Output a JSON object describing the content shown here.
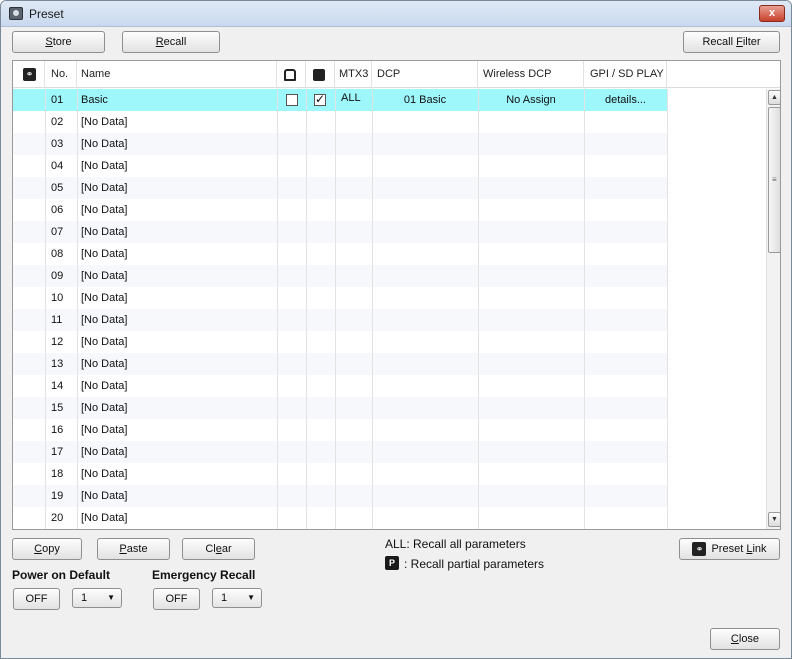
{
  "window": {
    "title": "Preset",
    "close_label": "x"
  },
  "toolbar": {
    "store": {
      "u": "S",
      "rest": "tore"
    },
    "recall": {
      "u": "R",
      "rest": "ecall"
    },
    "recall_filter": {
      "pre": "Recall ",
      "u": "F",
      "rest": "ilter"
    }
  },
  "columns": {
    "link_icon": "link-icon",
    "no": "No.",
    "name": "Name",
    "protect_icon": "lock-icon",
    "clock_icon": "clock-icon",
    "mtx": "MTX3",
    "dcp": "DCP",
    "wdcp": "Wireless DCP",
    "gpi": "GPI / SD PLAY"
  },
  "rows": [
    {
      "no": "01",
      "name": "Basic",
      "protect": false,
      "recall_safe": true,
      "mtx": "ALL",
      "dcp": "01 Basic",
      "wdcp": "No Assign",
      "gpi": "details..."
    },
    {
      "no": "02",
      "name": "[No Data]"
    },
    {
      "no": "03",
      "name": "[No Data]"
    },
    {
      "no": "04",
      "name": "[No Data]"
    },
    {
      "no": "05",
      "name": "[No Data]"
    },
    {
      "no": "06",
      "name": "[No Data]"
    },
    {
      "no": "07",
      "name": "[No Data]"
    },
    {
      "no": "08",
      "name": "[No Data]"
    },
    {
      "no": "09",
      "name": "[No Data]"
    },
    {
      "no": "10",
      "name": "[No Data]"
    },
    {
      "no": "11",
      "name": "[No Data]"
    },
    {
      "no": "12",
      "name": "[No Data]"
    },
    {
      "no": "13",
      "name": "[No Data]"
    },
    {
      "no": "14",
      "name": "[No Data]"
    },
    {
      "no": "15",
      "name": "[No Data]"
    },
    {
      "no": "16",
      "name": "[No Data]"
    },
    {
      "no": "17",
      "name": "[No Data]"
    },
    {
      "no": "18",
      "name": "[No Data]"
    },
    {
      "no": "19",
      "name": "[No Data]"
    },
    {
      "no": "20",
      "name": "[No Data]"
    }
  ],
  "bottom": {
    "copy": {
      "u": "C",
      "rest": "opy"
    },
    "paste": {
      "u": "P",
      "rest": "aste"
    },
    "clear": {
      "pre": "Cl",
      "u": "e",
      "rest": "ar"
    },
    "legend_all": "ALL: Recall all parameters",
    "legend_p_badge": "P",
    "legend_p": ": Recall partial parameters",
    "preset_link": {
      "pre": "Preset ",
      "u": "L",
      "rest": "ink"
    },
    "power_on_default": "Power on Default",
    "emergency_recall": "Emergency Recall",
    "power_toggle": "OFF",
    "power_select": "1",
    "emergency_toggle": "OFF",
    "emergency_select": "1",
    "close": {
      "u": "C",
      "rest": "lose"
    }
  }
}
